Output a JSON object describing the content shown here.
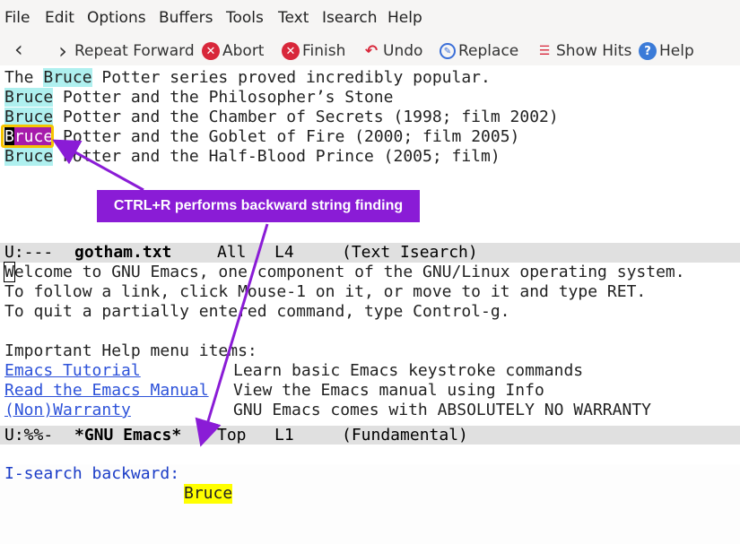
{
  "menu": [
    "File",
    "Edit",
    "Options",
    "Buffers",
    "Tools",
    "Text",
    "Isearch",
    "Help"
  ],
  "toolbar": {
    "repeat_forward": "Repeat Forward",
    "abort": "Abort",
    "finish": "Finish",
    "undo": "Undo",
    "replace": "Replace",
    "show_hits": "Show Hits",
    "help": "Help"
  },
  "editor": {
    "line1": {
      "before": "The ",
      "match": "Bruce",
      "after": " Potter series proved incredibly popular."
    },
    "line2": {
      "match": "Bruce",
      "after": " Potter and the Philosopher’s Stone"
    },
    "line3": {
      "match": "Bruce",
      "after": " Potter and the Chamber of Secrets (1998; film 2002)"
    },
    "line4": {
      "cursor_char": "B",
      "match_rest": "ruce",
      "after": " Potter and the Goblet of Fire (2000; film 2005)"
    },
    "line5": {
      "match": "Bruce",
      "after": " Potter and the Half-Blood Prince (2005; film)"
    }
  },
  "callout": "CTRL+R performs backward string finding",
  "modeline1": {
    "status": "U:---",
    "buffer": "gotham.txt",
    "position": "All",
    "line": "L4",
    "mode": "(Text Isearch)"
  },
  "welcome": {
    "l1_cursor": "W",
    "l1_rest": "elcome to GNU Emacs, one component of the GNU/Linux operating system.",
    "l2": "To follow a link, click Mouse-1 on it, or move to it and type RET.",
    "l3": "To quit a partially entered command, type Control-g.",
    "l5": "Important Help menu items:",
    "items": [
      {
        "link": "Emacs Tutorial",
        "desc": "Learn basic Emacs keystroke commands"
      },
      {
        "link": "Read the Emacs Manual",
        "desc": "View the Emacs manual using Info"
      },
      {
        "link": "(Non)Warranty",
        "desc": "GNU Emacs comes with ABSOLUTELY NO WARRANTY"
      }
    ]
  },
  "modeline2": {
    "status": "U:%%-",
    "buffer": "*GNU Emacs*",
    "position": "Top",
    "line": "L1",
    "mode": "(Fundamental)"
  },
  "echo": {
    "prompt": "I-search backward: ",
    "query": "Bruce"
  },
  "colors": {
    "accent": "#8a1cd6",
    "match_highlight": "#aff0ef",
    "current_match": "#a61bab",
    "query_highlight": "#ffff00"
  }
}
